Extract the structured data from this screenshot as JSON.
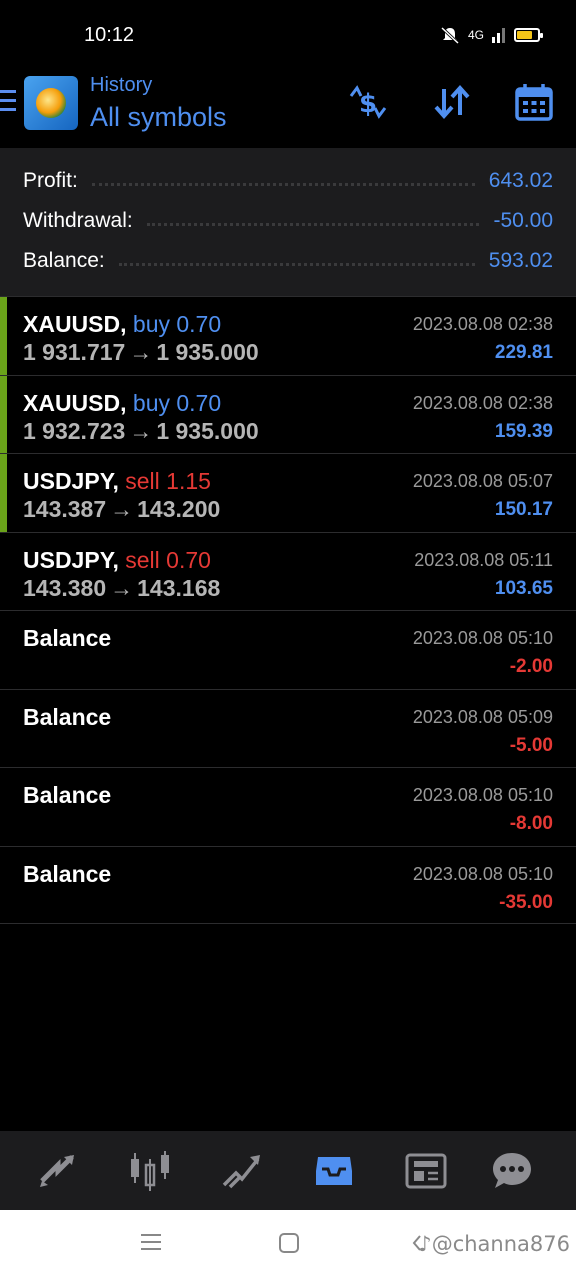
{
  "status_bar": {
    "time": "10:12",
    "network": "4G",
    "battery_level": 0.75,
    "battery_color": "#f5c518"
  },
  "header": {
    "subtitle": "History",
    "title": "All symbols",
    "icons": [
      "menu-icon",
      "app-logo",
      "currency-exchange-icon",
      "sort-icon",
      "calendar-icon"
    ],
    "accent_color": "#4f8ff0"
  },
  "summary": {
    "profit_label": "Profit:",
    "profit_value": "643.02",
    "withdrawal_label": "Withdrawal:",
    "withdrawal_value": "-50.00",
    "balance_label": "Balance:",
    "balance_value": "593.02"
  },
  "deals": [
    {
      "symbol": "XAUUSD,",
      "direction": "buy",
      "volume": "0.70",
      "direction_text": "buy 0.70",
      "open_price": "1 931.717",
      "close_price": "1 935.000",
      "date": "2023.08.08 02:38",
      "amount": "229.81"
    },
    {
      "symbol": "XAUUSD,",
      "direction": "buy",
      "volume": "0.70",
      "direction_text": "buy 0.70",
      "open_price": "1 932.723",
      "close_price": "1 935.000",
      "date": "2023.08.08 02:38",
      "amount": "159.39"
    },
    {
      "symbol": "USDJPY,",
      "direction": "sell",
      "volume": "1.15",
      "direction_text": "sell 1.15",
      "open_price": "143.387",
      "close_price": "143.200",
      "date": "2023.08.08 05:07",
      "amount": "150.17"
    },
    {
      "symbol": "USDJPY,",
      "direction": "sell",
      "volume": "0.70",
      "direction_text": "sell 0.70",
      "open_price": "143.380",
      "close_price": "143.168",
      "date": "2023.08.08 05:11",
      "amount": "103.65"
    },
    {
      "symbol": "Balance",
      "date": "2023.08.08 05:10",
      "amount": "-2.00"
    },
    {
      "symbol": "Balance",
      "date": "2023.08.08 05:09",
      "amount": "-5.00"
    },
    {
      "symbol": "Balance",
      "date": "2023.08.08 05:10",
      "amount": "-8.00"
    },
    {
      "symbol": "Balance",
      "date": "2023.08.08 05:10",
      "amount": "-35.00"
    }
  ],
  "price_arrow": "→",
  "bottom_nav": {
    "items": [
      "quotes-icon",
      "chart-icon",
      "trade-icon",
      "history-icon",
      "news-icon",
      "chat-icon"
    ],
    "active": "history-icon",
    "active_color": "#4f8ff0",
    "inactive_color": "#8e8e93"
  },
  "system_nav": {
    "watermark": "@channa876"
  },
  "colors": {
    "positive": "#4f8ff0",
    "negative": "#e53935",
    "buy": "#4f8ff0",
    "sell": "#e53935",
    "row_accent": "#6aa31a"
  }
}
